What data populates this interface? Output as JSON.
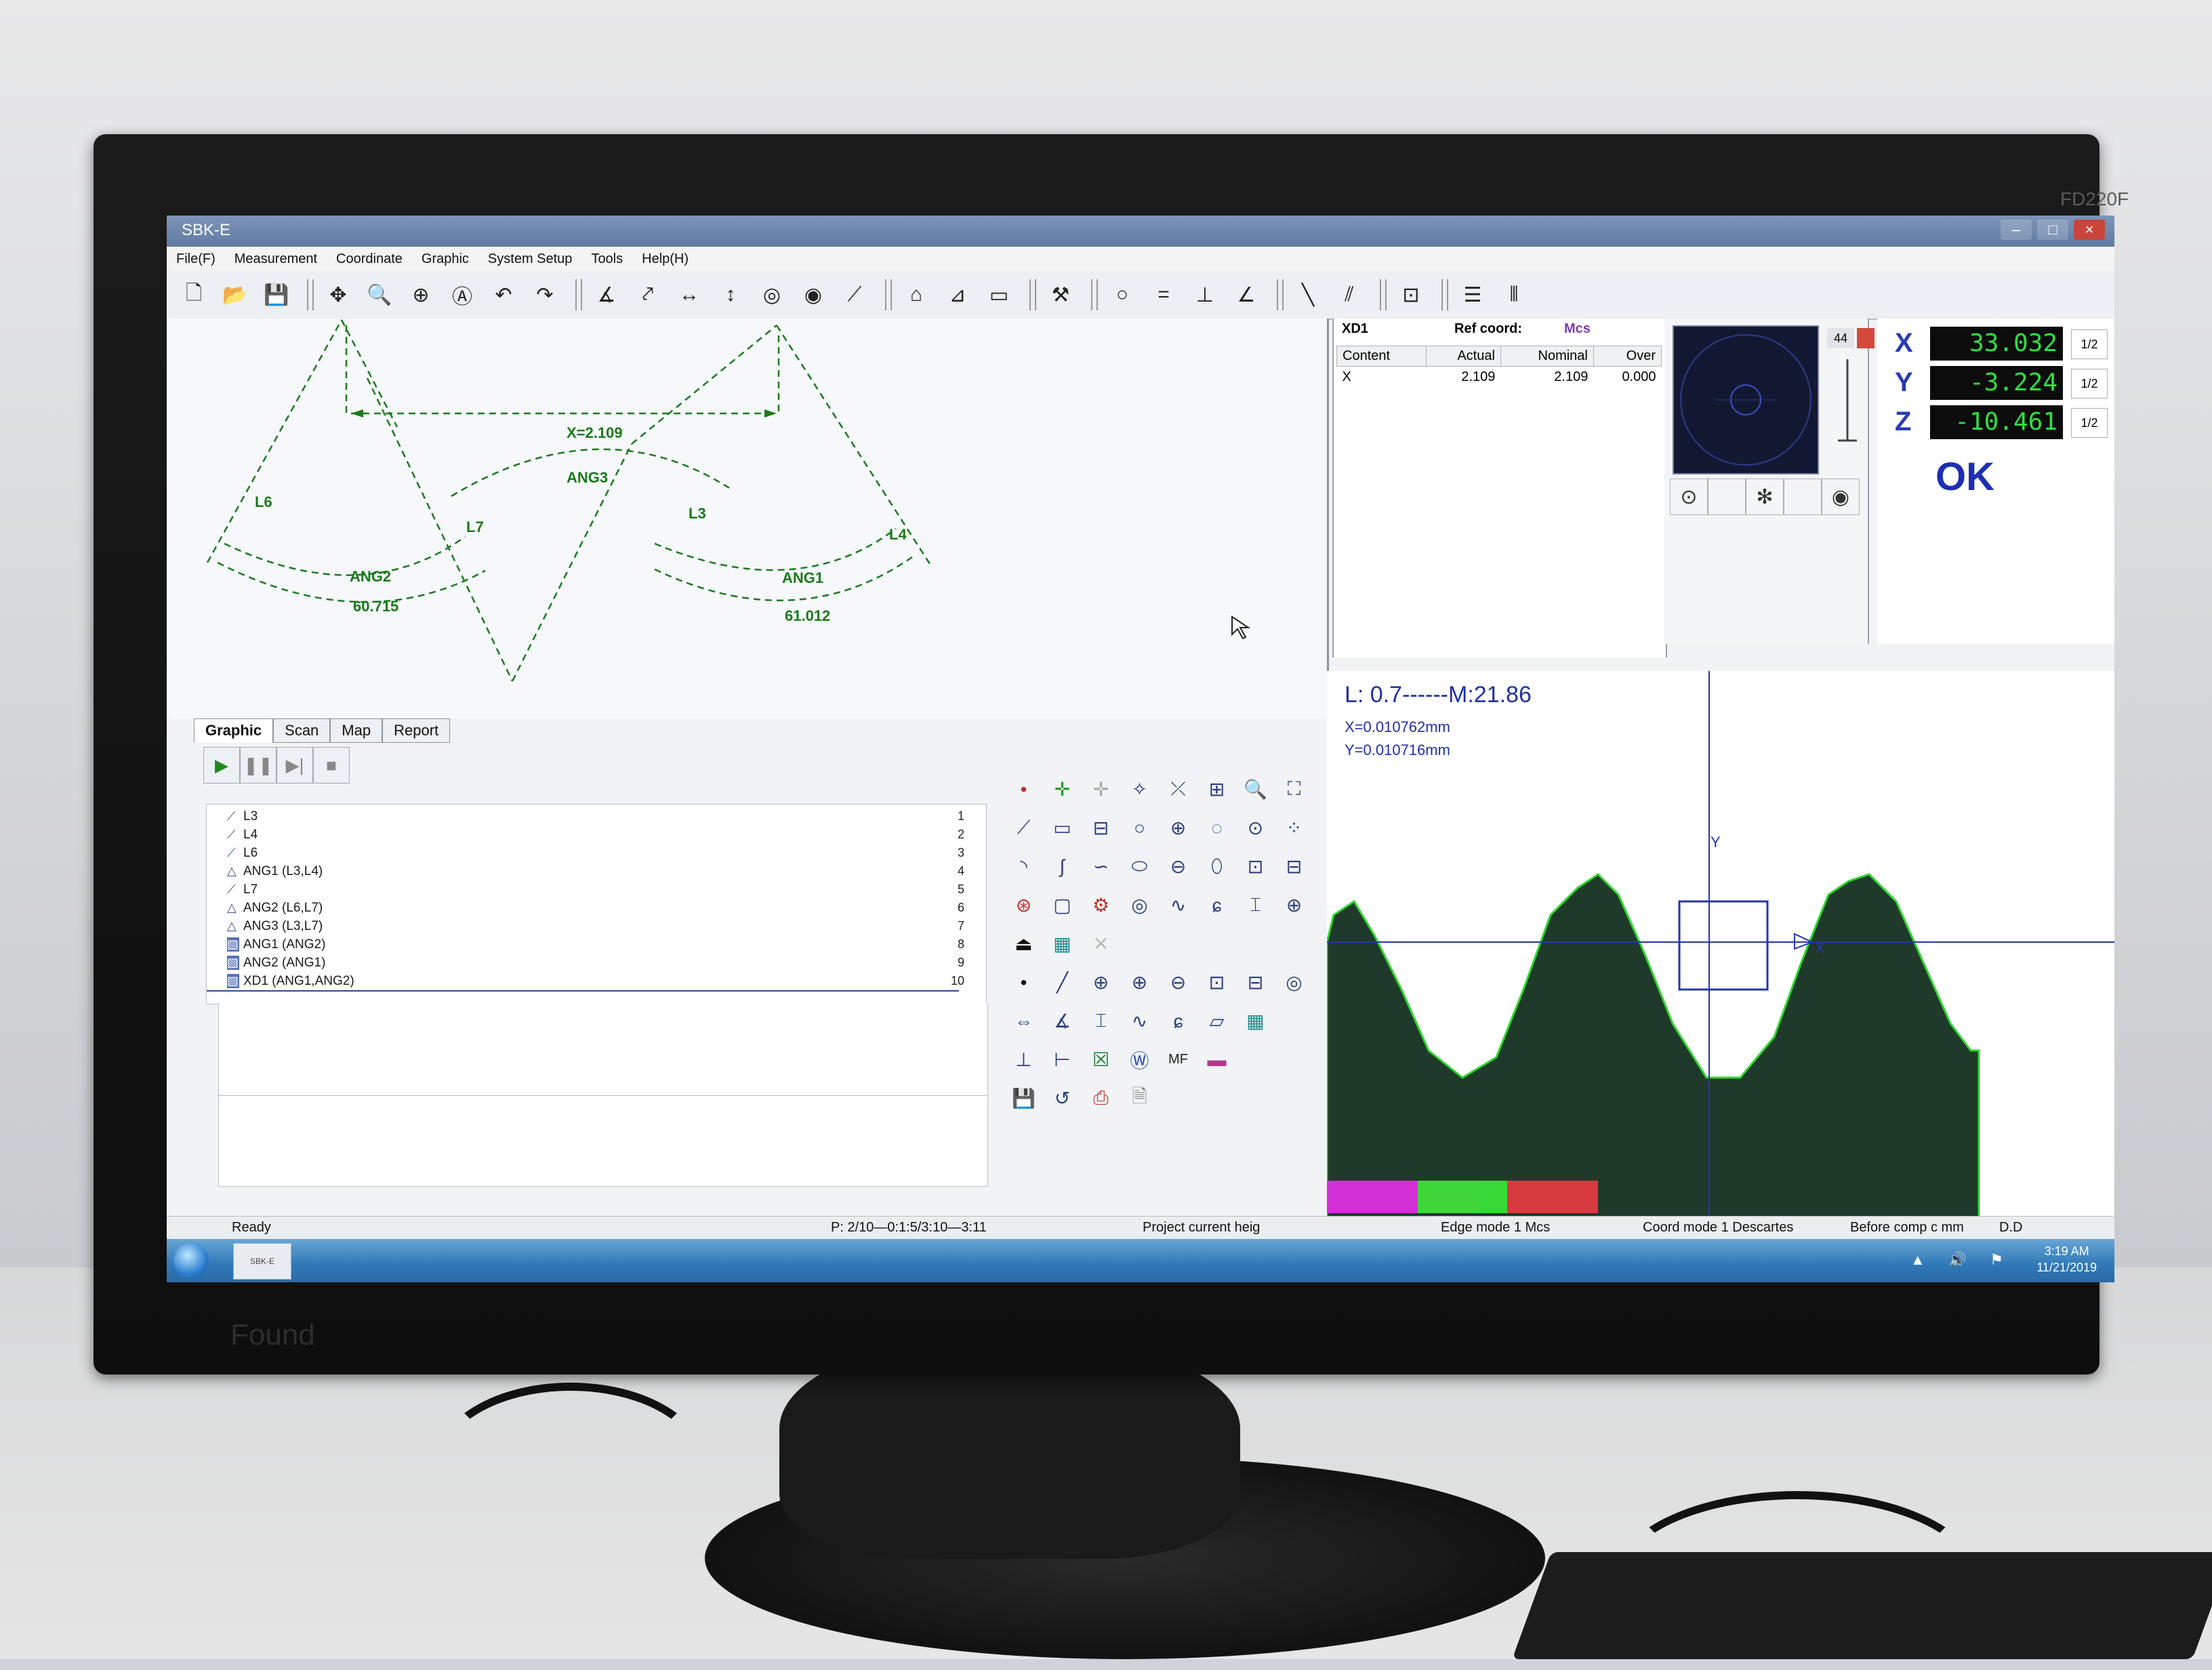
{
  "monitor": {
    "brand": "Found",
    "model": "FD220F"
  },
  "window": {
    "title": "SBK-E"
  },
  "menu": [
    "File(F)",
    "Measurement",
    "Coordinate",
    "Graphic",
    "System Setup",
    "Tools",
    "Help(H)"
  ],
  "graphic": {
    "labels": {
      "dimension": "X=2.109",
      "ang3": "ANG3",
      "ang2": "ANG2",
      "ang2_value": "60.715",
      "ang1": "ANG1",
      "ang1_value": "61.012",
      "l6": "L6",
      "l7": "L7",
      "l3": "L3",
      "l4": "L4"
    }
  },
  "tabs": [
    "Graphic",
    "Scan",
    "Map",
    "Report"
  ],
  "program": [
    {
      "label": "L3",
      "num": "1"
    },
    {
      "label": "L4",
      "num": "2"
    },
    {
      "label": "L6",
      "num": "3"
    },
    {
      "label": "ANG1 (L3,L4)",
      "num": "4"
    },
    {
      "label": "L7",
      "num": "5"
    },
    {
      "label": "ANG2 (L6,L7)",
      "num": "6"
    },
    {
      "label": "ANG3 (L3,L7)",
      "num": "7"
    },
    {
      "label": "ANG1 (ANG2)",
      "num": "8"
    },
    {
      "label": "ANG2 (ANG1)",
      "num": "9"
    },
    {
      "label": "XD1 (ANG1,ANG2)",
      "num": "10"
    }
  ],
  "dimension_panel": {
    "name": "XD1",
    "ref_label": "Ref coord:",
    "ref_value": "Mcs",
    "columns": [
      "Content",
      "Actual",
      "Nominal",
      "Over"
    ],
    "rows": [
      {
        "content": "X",
        "actual": "2.109",
        "nominal": "2.109",
        "over": "0.000"
      }
    ]
  },
  "scope": {
    "value": "44"
  },
  "dro": {
    "x_label": "X",
    "x_value": "33.032",
    "x_res": "1/2",
    "y_label": "Y",
    "y_value": "-3.224",
    "y_res": "1/2",
    "z_label": "Z",
    "z_value": "-10.461",
    "z_res": "1/2",
    "status": "OK"
  },
  "camera": {
    "line1": "L: 0.7------M:21.86",
    "line2": "X=0.010762mm",
    "line3": "Y=0.010716mm",
    "axis_y": "Y",
    "axis_x": "X",
    "strip_colors": [
      "#d32fd6",
      "#3fd63a",
      "#39d839",
      "#d63a3f"
    ]
  },
  "status": {
    "ready": "Ready",
    "position": "P: 2/10—0:1:5/3:10—3:11",
    "project": "Project current heig",
    "edge_mode": "Edge mode 1 Mcs",
    "coord_mode": "Coord mode 1  Descartes",
    "comp": "Before comp c mm",
    "dd": "D.D"
  },
  "taskbar": {
    "app": "SBK-E",
    "time": "3:19 AM",
    "date": "11/21/2019"
  }
}
